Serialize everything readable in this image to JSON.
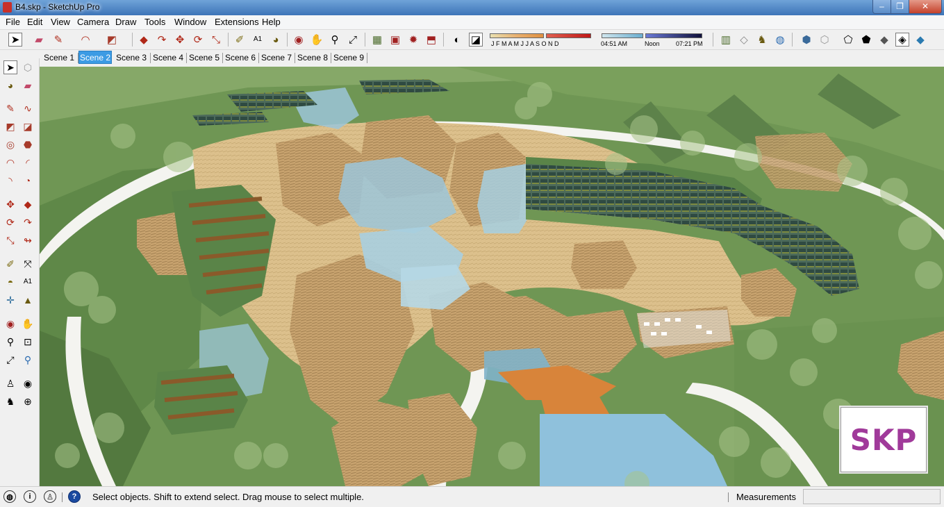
{
  "window": {
    "title": "B4.skp - SketchUp Pro",
    "min": "–",
    "max": "❐",
    "close": "✕"
  },
  "menu": [
    "File",
    "Edit",
    "View",
    "Camera",
    "Draw",
    "Tools",
    "Window",
    "Extensions",
    "Help"
  ],
  "shadow": {
    "months": "J F M A M J J A S O N D",
    "time_start": "04:51 AM",
    "time_mid": "Noon",
    "time_end": "07:21 PM"
  },
  "scenes": {
    "tabs": [
      "Scene 1",
      "Scene 2",
      "Scene 3",
      "Scene 4",
      "Scene 5",
      "Scene 6",
      "Scene 7",
      "Scene 8",
      "Scene 9"
    ],
    "active": "Scene 2"
  },
  "badge": {
    "text": "SKP"
  },
  "status": {
    "message": "Select objects. Shift to extend select. Drag mouse to select multiple.",
    "measurements_label": "Measurements",
    "measurements_value": ""
  },
  "colors": {
    "accent": "#3c9be4",
    "grass": "#6f9654",
    "timber": "#c7a26e",
    "glass": "#9cc6d9",
    "water": "#8fc1dc",
    "badge": "#a03a9a"
  }
}
